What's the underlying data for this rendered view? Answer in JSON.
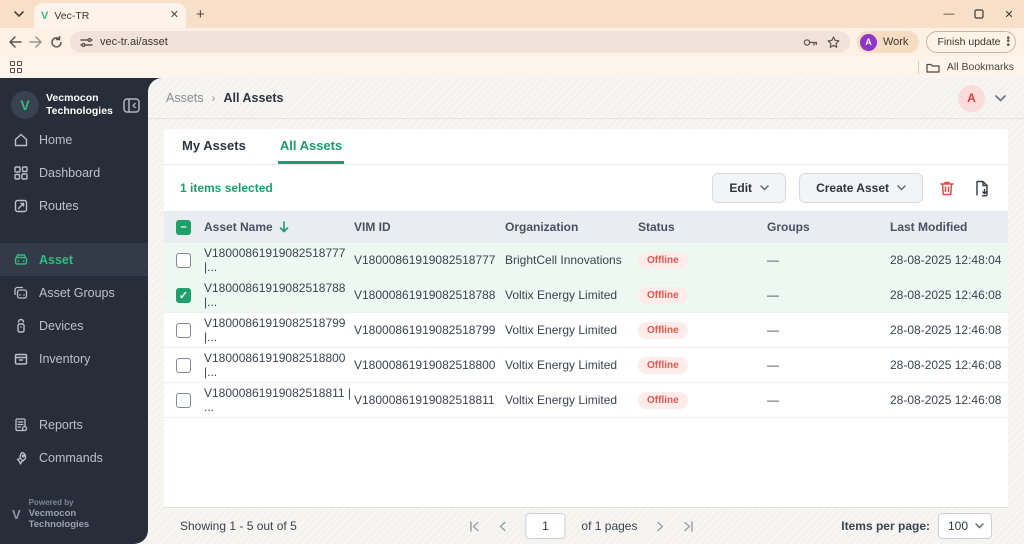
{
  "browser": {
    "tab_title": "Vec-TR",
    "url": "vec-tr.ai/asset",
    "profile_initial": "A",
    "profile_label": "Work",
    "update_label": "Finish update",
    "bookmarks_label": "All Bookmarks"
  },
  "sidebar": {
    "org_name": "Vecmocon Technologies",
    "items": [
      {
        "label": "Home",
        "active": false
      },
      {
        "label": "Dashboard",
        "active": false
      },
      {
        "label": "Routes",
        "active": false
      },
      {
        "label": "Asset",
        "active": true
      },
      {
        "label": "Asset Groups",
        "active": false
      },
      {
        "label": "Devices",
        "active": false
      },
      {
        "label": "Inventory",
        "active": false
      },
      {
        "label": "Reports",
        "active": false
      },
      {
        "label": "Commands",
        "active": false
      }
    ],
    "footer": {
      "powered_by": "Powered by",
      "company": "Vecmocon Technologies"
    }
  },
  "header": {
    "breadcrumb_root": "Assets",
    "breadcrumb_current": "All Assets",
    "avatar_initial": "A"
  },
  "tabs": [
    {
      "label": "My Assets",
      "active": false
    },
    {
      "label": "All Assets",
      "active": true
    }
  ],
  "toolbar": {
    "selection_text": "1 items selected",
    "edit_label": "Edit",
    "create_label": "Create Asset"
  },
  "table": {
    "header_checkbox_state": "indeterminate",
    "columns": [
      "Asset Name",
      "VIM ID",
      "Organization",
      "Status",
      "Groups",
      "Last Modified"
    ],
    "rows": [
      {
        "checked": false,
        "highlight": true,
        "asset_name": "V18000861919082518777 |...",
        "vim_id": "V18000861919082518777",
        "organization": "BrightCell Innovations",
        "status": "Offline",
        "groups": "—",
        "last_modified": "28-08-2025 12:48:04"
      },
      {
        "checked": true,
        "highlight": true,
        "asset_name": "V18000861919082518788 |...",
        "vim_id": "V18000861919082518788",
        "organization": "Voltix Energy Limited",
        "status": "Offline",
        "groups": "—",
        "last_modified": "28-08-2025 12:46:08"
      },
      {
        "checked": false,
        "highlight": false,
        "asset_name": "V18000861919082518799 |...",
        "vim_id": "V18000861919082518799",
        "organization": "Voltix Energy Limited",
        "status": "Offline",
        "groups": "—",
        "last_modified": "28-08-2025 12:46:08"
      },
      {
        "checked": false,
        "highlight": false,
        "asset_name": "V18000861919082518800 |...",
        "vim_id": "V18000861919082518800",
        "organization": "Voltix Energy Limited",
        "status": "Offline",
        "groups": "—",
        "last_modified": "28-08-2025 12:46:08"
      },
      {
        "checked": false,
        "highlight": false,
        "asset_name": "V18000861919082518811 | ...",
        "vim_id": "V18000861919082518811",
        "organization": "Voltix Energy Limited",
        "status": "Offline",
        "groups": "—",
        "last_modified": "28-08-2025 12:46:08"
      }
    ]
  },
  "pagination": {
    "summary": "Showing 1 - 5 out of 5",
    "page_value": "1",
    "pages_text": "of 1 pages",
    "items_per_page_label": "Items per page:",
    "items_per_page_value": "100"
  },
  "colors": {
    "accent_green": "#1b9e6e",
    "logo_green": "#2fbe7d",
    "status_offline_text": "#e2574f",
    "status_offline_bg": "#fdecea",
    "sidebar_bg": "#272e3a",
    "table_header_bg": "#e9edf2",
    "row_highlight_bg": "#edf8f2",
    "chrome_peach": "#f7dfc8",
    "profile_purple": "#8f35c9",
    "avatar_red": "#d53f3f"
  }
}
